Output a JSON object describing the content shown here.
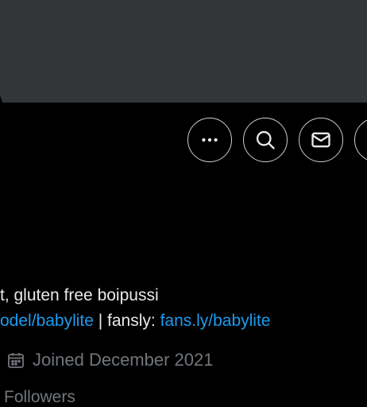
{
  "header": {
    "banner_color": "#333639"
  },
  "actions": {
    "more_icon": "more-horizontal-icon",
    "search_icon": "search-icon",
    "message_icon": "envelope-icon"
  },
  "bio": {
    "line1": "t, gluten free boipussi",
    "link1": "odel/babylite",
    "separator": " | fansly: ",
    "link2": "fans.ly/babylite"
  },
  "profile_meta": {
    "joined_icon": "calendar-icon",
    "joined": "Joined December 2021"
  },
  "stats": {
    "followers_label": "Followers"
  },
  "colors": {
    "background": "#000000",
    "text": "#e7e9ea",
    "secondary_text": "#71767b",
    "link": "#1d9bf0",
    "button_border": "#c9cdd1"
  }
}
